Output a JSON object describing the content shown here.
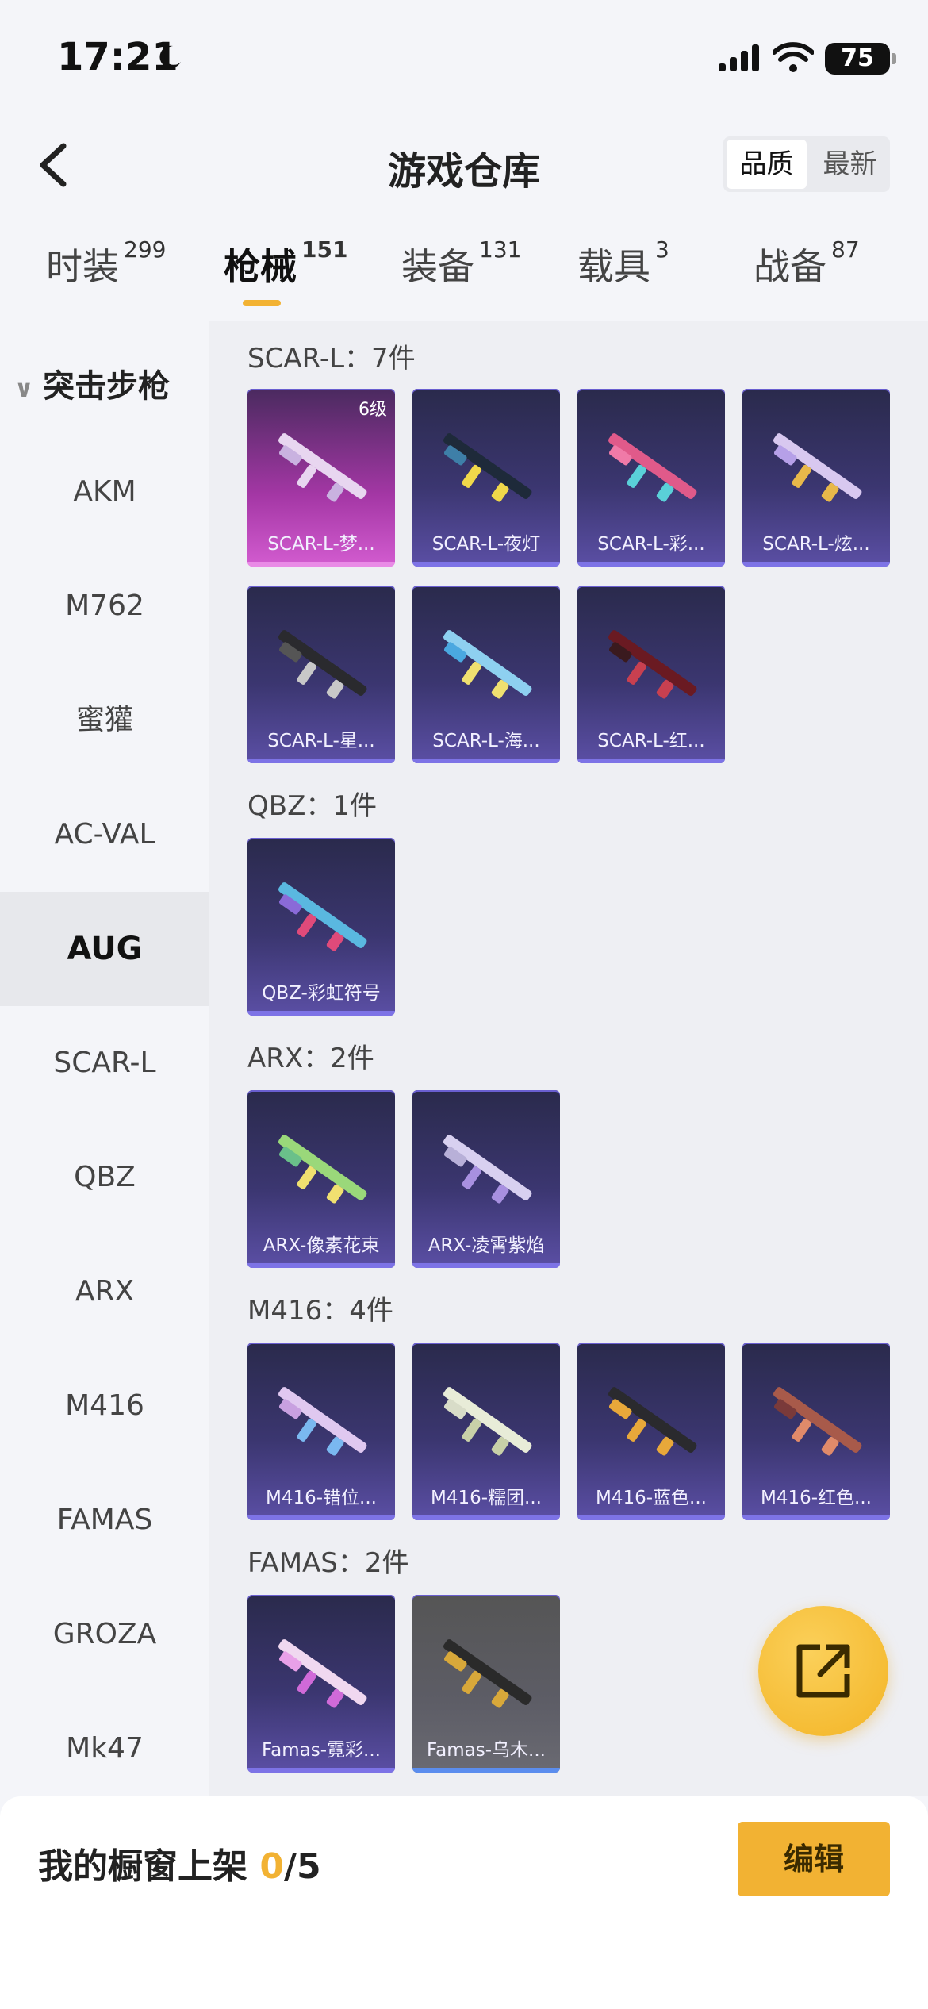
{
  "status_bar": {
    "time": "17:21",
    "battery": "75"
  },
  "header": {
    "title": "游戏仓库",
    "sort_quality": "品质",
    "sort_latest": "最新"
  },
  "tabs": [
    {
      "label": "时装",
      "count": "299"
    },
    {
      "label": "枪械",
      "count": "151"
    },
    {
      "label": "装备",
      "count": "131"
    },
    {
      "label": "载具",
      "count": "3"
    },
    {
      "label": "战备",
      "count": "87"
    }
  ],
  "sidebar": {
    "group": "突击步枪",
    "items": [
      "AKM",
      "M762",
      "蜜獾",
      "AC-VAL",
      "AUG",
      "SCAR-L",
      "QBZ",
      "ARX",
      "M416",
      "FAMAS",
      "GROZA",
      "Mk47"
    ],
    "active": "AUG"
  },
  "groups": [
    {
      "title": "SCAR-L：7件",
      "items": [
        {
          "name": "SCAR-L-梦...",
          "level": "6级"
        },
        {
          "name": "SCAR-L-夜灯"
        },
        {
          "name": "SCAR-L-彩..."
        },
        {
          "name": "SCAR-L-炫..."
        },
        {
          "name": "SCAR-L-星..."
        },
        {
          "name": "SCAR-L-海..."
        },
        {
          "name": "SCAR-L-红..."
        }
      ]
    },
    {
      "title": "QBZ：1件",
      "items": [
        {
          "name": "QBZ-彩虹符号"
        }
      ]
    },
    {
      "title": "ARX：2件",
      "items": [
        {
          "name": "ARX-像素花束"
        },
        {
          "name": "ARX-凌霄紫焰"
        }
      ]
    },
    {
      "title": "M416：4件",
      "items": [
        {
          "name": "M416-错位..."
        },
        {
          "name": "M416-糯团..."
        },
        {
          "name": "M416-蓝色..."
        },
        {
          "name": "M416-红色..."
        }
      ]
    },
    {
      "title": "FAMAS：2件",
      "items": [
        {
          "name": "Famas-霓彩..."
        },
        {
          "name": "Famas-乌木..."
        }
      ]
    }
  ],
  "bottom": {
    "label": "我的橱窗上架",
    "count": "0",
    "total": "/5",
    "edit": "编辑"
  },
  "colors": {
    "accent": "#f2b233",
    "card_purple": "#3b3670",
    "card_pink": "#a437a5"
  },
  "icons": [
    "moon-icon",
    "signal-icon",
    "wifi-icon",
    "back-icon",
    "chevron-down-icon",
    "gun-icon",
    "share-icon"
  ]
}
